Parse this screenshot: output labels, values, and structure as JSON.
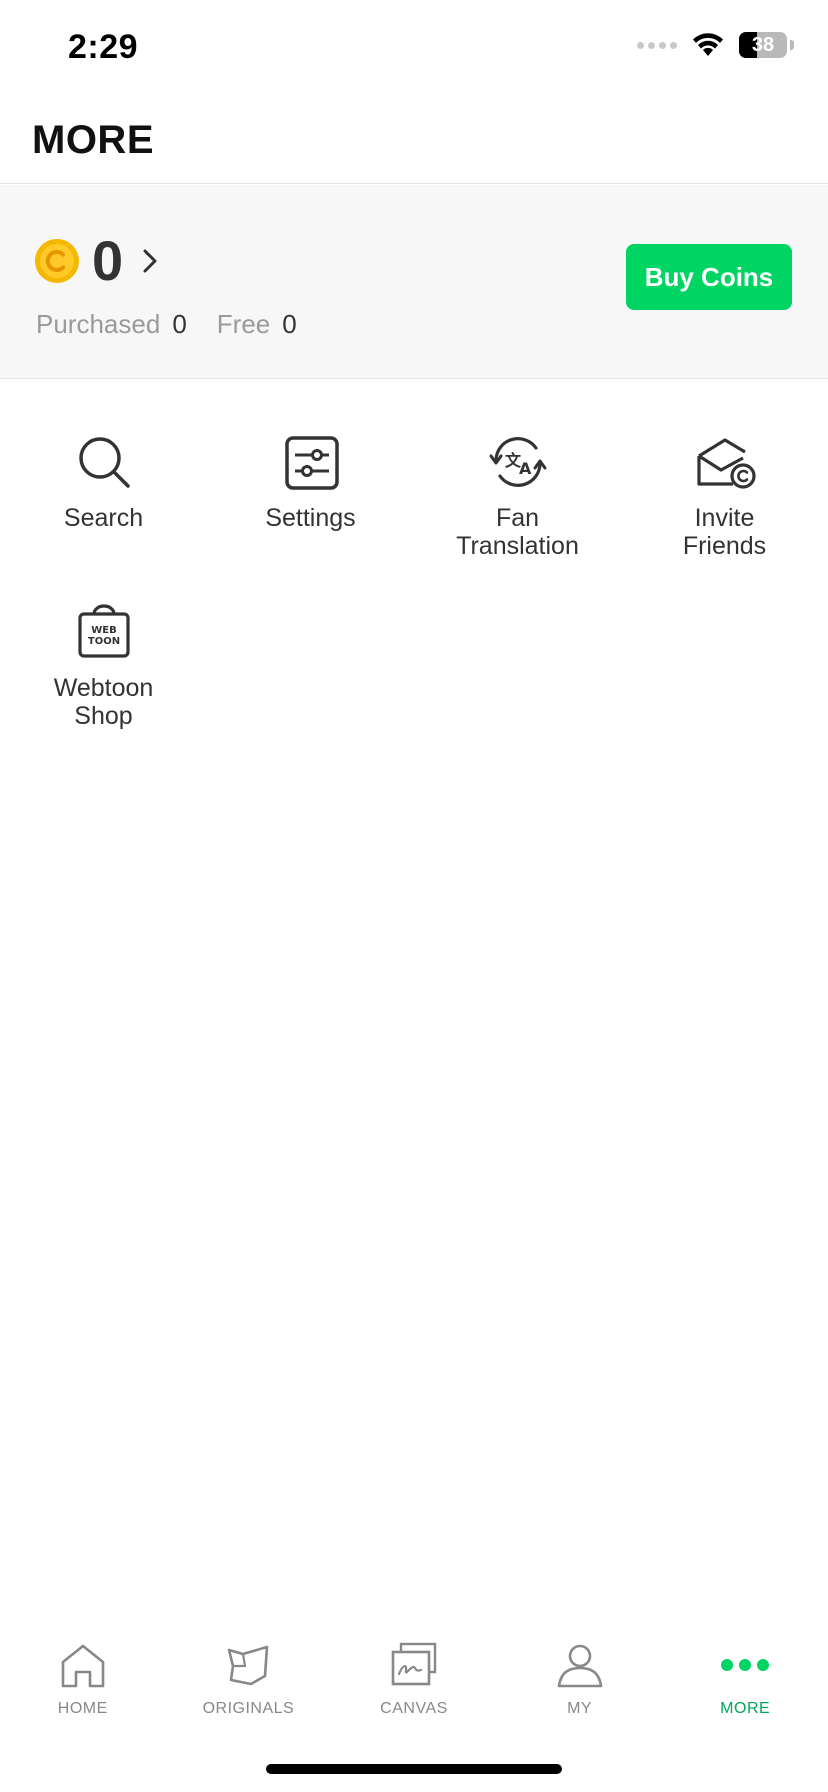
{
  "status_bar": {
    "time": "2:29",
    "battery": "38",
    "battery_level": 38
  },
  "header": {
    "title": "MORE"
  },
  "coins": {
    "balance": "0",
    "purchased_label": "Purchased",
    "purchased_value": "0",
    "free_label": "Free",
    "free_value": "0",
    "buy_label": "Buy Coins",
    "coin_color": "#f5b800",
    "accent": "#00d564"
  },
  "menu": {
    "items": [
      {
        "label": "Search",
        "icon": "search-icon"
      },
      {
        "label": "Settings",
        "icon": "sliders-icon"
      },
      {
        "label": "Fan\nTranslation",
        "icon": "translate-icon"
      },
      {
        "label": "Invite\nFriends",
        "icon": "envelope-coin-icon"
      },
      {
        "label": "Webtoon\nShop",
        "icon": "shopping-bag-icon"
      }
    ]
  },
  "bottom_nav": {
    "active_color": "#00a85a",
    "items": [
      {
        "label": "HOME",
        "icon": "home-icon"
      },
      {
        "label": "ORIGINALS",
        "icon": "originals-icon"
      },
      {
        "label": "CANVAS",
        "icon": "canvas-icon"
      },
      {
        "label": "MY",
        "icon": "person-icon"
      },
      {
        "label": "MORE",
        "icon": "more-dots-icon"
      }
    ]
  }
}
